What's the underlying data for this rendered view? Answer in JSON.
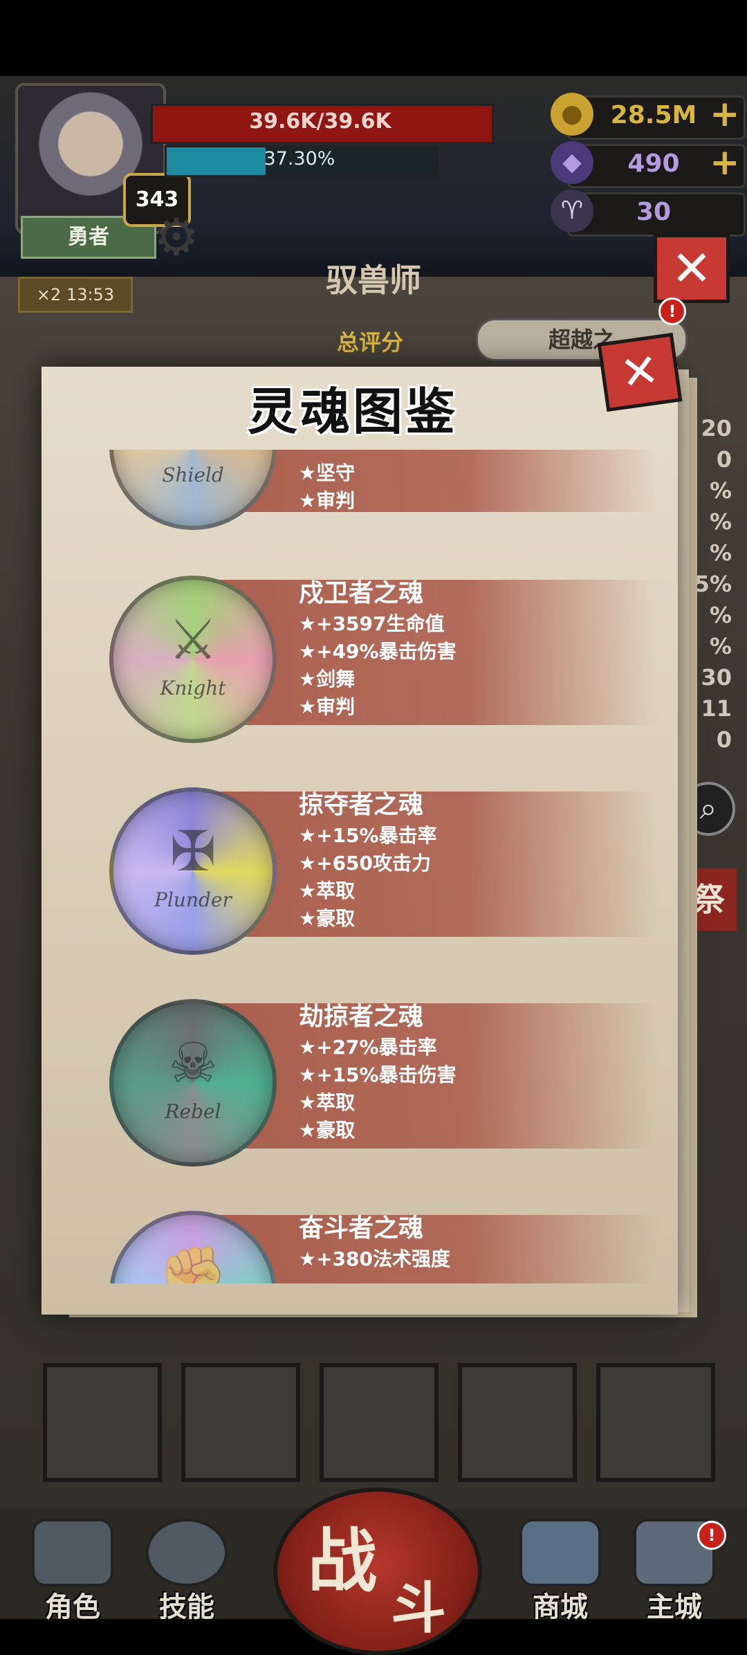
{
  "player": {
    "hp_text": "39.6K/39.6K",
    "xp_text": "37.30%",
    "xp_progress": 0.373,
    "level": "343",
    "title": "勇者"
  },
  "resources": {
    "gold": "28.5M",
    "gems": "490",
    "keys": "30"
  },
  "timer": {
    "multiplier": "×2",
    "time": "13:53"
  },
  "class_title": "驭兽师",
  "score_label": "总评分",
  "transcend_label": "超越之",
  "side_values": [
    "20",
    "0",
    "%",
    "%",
    "%",
    "5%",
    "%",
    "%",
    "30",
    "11",
    "0"
  ],
  "side_button": "祭",
  "modal": {
    "title": "灵魂图鉴",
    "souls": [
      {
        "name": "",
        "seal_word": "Shield",
        "attrs": [
          "★坚守",
          "★审判"
        ]
      },
      {
        "name": "戍卫者之魂",
        "seal_word": "Knight",
        "attrs": [
          "★+3597生命值",
          "★+49%暴击伤害",
          "★剑舞",
          "★审判"
        ]
      },
      {
        "name": "掠夺者之魂",
        "seal_word": "Plunder",
        "attrs": [
          "★+15%暴击率",
          "★+650攻击力",
          "★萃取",
          "★豪取"
        ]
      },
      {
        "name": "劫掠者之魂",
        "seal_word": "Rebel",
        "attrs": [
          "★+27%暴击率",
          "★+15%暴击伤害",
          "★萃取",
          "★豪取"
        ]
      },
      {
        "name": "奋斗者之魂",
        "seal_word": "",
        "attrs": [
          "★+380法术强度"
        ]
      }
    ]
  },
  "nav": {
    "role": "角色",
    "skill": "技能",
    "battle_a": "战",
    "battle_b": "斗",
    "shop": "商城",
    "city": "主城"
  },
  "colors": {
    "hp": "#8f1612",
    "xp": "#1d8aa0",
    "band": "#a75848",
    "gold": "#d8b540",
    "gem_text": "#b49be0",
    "close": "#c73a34"
  }
}
